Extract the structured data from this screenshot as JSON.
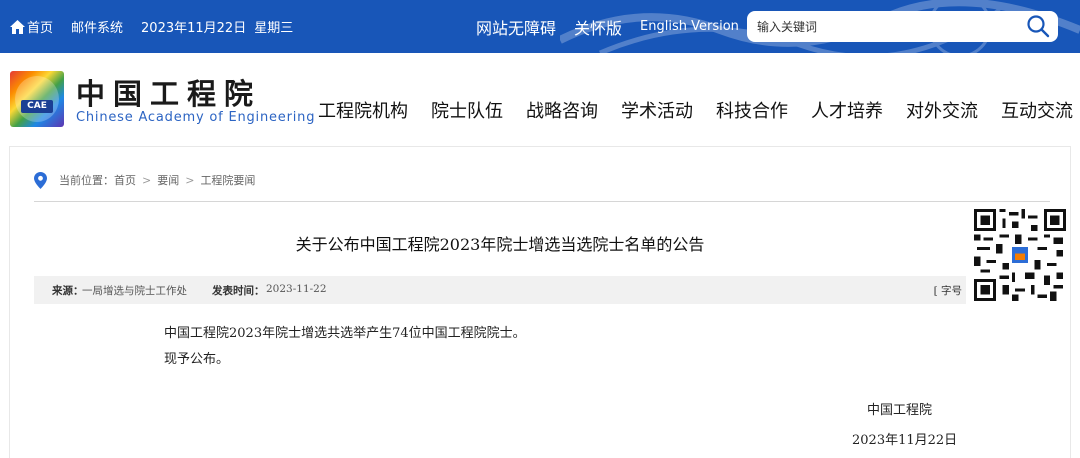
{
  "topbar": {
    "home": "首页",
    "mail": "邮件系统",
    "date": "2023年11月22日",
    "weekday": "星期三",
    "accessibility": "网站无障碍",
    "care_mode": "关怀版",
    "english": "English Version",
    "search_placeholder": "输入关键词"
  },
  "header": {
    "logo_badge_text": "CAE",
    "logo_cn": "中国工程院",
    "logo_en": "Chinese Academy of Engineering",
    "nav": [
      "工程院机构",
      "院士队伍",
      "战略咨询",
      "学术活动",
      "科技合作",
      "人才培养",
      "对外交流",
      "互动交流"
    ]
  },
  "breadcrumb": {
    "prefix": "当前位置：",
    "items": [
      "首页",
      "要闻",
      "工程院要闻"
    ]
  },
  "article": {
    "title": "关于公布中国工程院2023年院士增选当选院士名单的公告",
    "source_label": "来源：",
    "source": "一局增选与院士工作处",
    "time_label": "发表时间：",
    "time": "2023-11-22",
    "font_size_label": "[ 字号",
    "paragraphs": [
      "中国工程院2023年院士增选共选举产生74位中国工程院院士。",
      "现予公布。"
    ],
    "signature_org": "中国工程院",
    "signature_date": "2023年11月22日"
  },
  "colors": {
    "topbar_bg": "#1856b8",
    "link_blue": "#2c64c3",
    "meta_bg": "#f1f1f1"
  },
  "icons": [
    "home-icon",
    "search-icon",
    "location-pin-icon",
    "qr-code-icon",
    "logo-badge"
  ]
}
